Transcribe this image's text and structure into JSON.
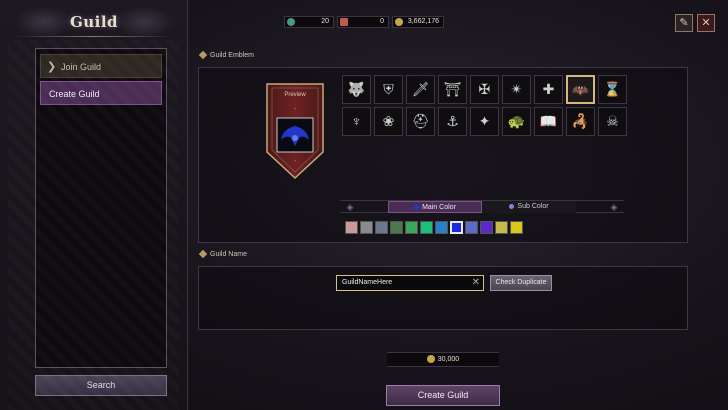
{
  "sidebar": {
    "title": "Guild",
    "items": [
      {
        "label": "Join Guild"
      },
      {
        "label": "Create Guild"
      }
    ],
    "search_label": "Search"
  },
  "currency": [
    {
      "icon": "gem-icon",
      "value": "20",
      "color": "#4a9a7a"
    },
    {
      "icon": "ticket-icon",
      "value": "0",
      "color": "#c05a4a"
    },
    {
      "icon": "gold-coin-icon",
      "value": "3,662,176",
      "color": "#c9a64a"
    }
  ],
  "top_buttons": [
    {
      "icon": "guild-book-icon"
    },
    {
      "icon": "close-icon"
    }
  ],
  "emblem_section": {
    "label": "Guild Emblem",
    "preview_label": "Preview",
    "emblems": [
      {
        "icon": "wolf-icon",
        "glyph": "🐺"
      },
      {
        "icon": "shield-icon",
        "glyph": "⛨"
      },
      {
        "icon": "sword-icon",
        "glyph": "🗡"
      },
      {
        "icon": "gate-icon",
        "glyph": "⛩"
      },
      {
        "icon": "crossed-blades-icon",
        "glyph": "✠"
      },
      {
        "icon": "star-burst-icon",
        "glyph": "✴"
      },
      {
        "icon": "cross-icon",
        "glyph": "✚"
      },
      {
        "icon": "wings-icon",
        "glyph": "🦇"
      },
      {
        "icon": "hourglass-icon",
        "glyph": "⌛"
      },
      {
        "icon": "lyre-icon",
        "glyph": "♆"
      },
      {
        "icon": "rose-icon",
        "glyph": "❀"
      },
      {
        "icon": "helmet-icon",
        "glyph": "⛑"
      },
      {
        "icon": "anchor-icon",
        "glyph": "⚓"
      },
      {
        "icon": "compass-star-icon",
        "glyph": "✦"
      },
      {
        "icon": "turtle-icon",
        "glyph": "🐢"
      },
      {
        "icon": "open-book-icon",
        "glyph": "📖"
      },
      {
        "icon": "scorpion-icon",
        "glyph": "🦂"
      },
      {
        "icon": "bull-skull-icon",
        "glyph": "☠"
      }
    ],
    "selected_index": 7
  },
  "color_section": {
    "main_tab": "Main Color",
    "sub_tab": "Sub Color",
    "main_dot_color": "#1a3ad8",
    "sub_dot_color": "#7a8ad8",
    "swatches": [
      "#c89a9a",
      "#8a8a8a",
      "#6a7a8a",
      "#4a7a4a",
      "#3aa85a",
      "#1ac078",
      "#2a80c8",
      "#1a2ad8",
      "#5a6ac8",
      "#5a2ac8",
      "#c8b84a",
      "#d8c818"
    ],
    "selected_index": 7
  },
  "name_section": {
    "label": "Guild Name",
    "input_value": "GuildNameHere",
    "check_label": "Check Duplicate"
  },
  "cost": "30,000",
  "create_label": "Create Guild"
}
